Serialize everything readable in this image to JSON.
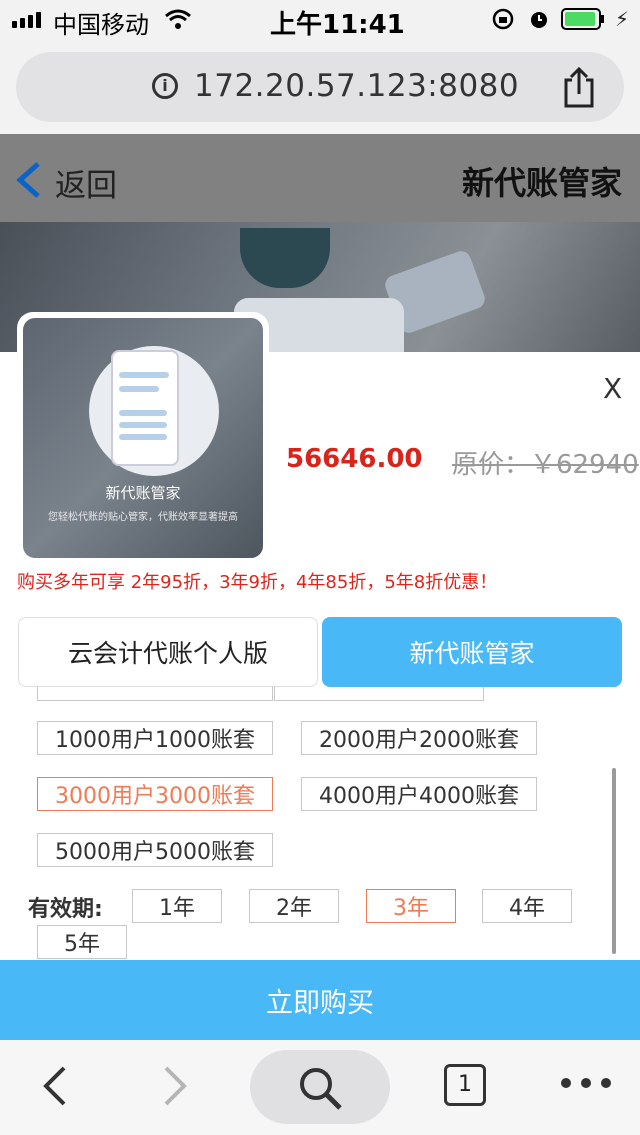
{
  "status_bar": {
    "carrier": "中国移动",
    "time": "上午11:41"
  },
  "browser": {
    "url": "172.20.57.123:8080",
    "open_tabs": "1"
  },
  "header": {
    "back_label": "返回",
    "title": "新代账管家"
  },
  "product": {
    "thumb_title": "新代账管家",
    "thumb_subtitle": "您轻松代账的贴心管家，代账效率显著提高",
    "price": "56646.00",
    "original_price": "原价：￥62940",
    "close_label": "X",
    "promo": "购买多年可享 2年95折，3年9折，4年85折，5年8折优惠！"
  },
  "tabs": [
    {
      "label": "云会计代账个人版",
      "active": false
    },
    {
      "label": "新代账管家",
      "active": true
    }
  ],
  "plans": [
    {
      "label": "1000用户1000账套",
      "selected": false
    },
    {
      "label": "2000用户2000账套",
      "selected": false
    },
    {
      "label": "3000用户3000账套",
      "selected": true
    },
    {
      "label": "4000用户4000账套",
      "selected": false
    },
    {
      "label": "5000用户5000账套",
      "selected": false
    }
  ],
  "validity": {
    "label": "有效期:",
    "options": [
      {
        "label": "1年",
        "selected": false
      },
      {
        "label": "2年",
        "selected": false
      },
      {
        "label": "3年",
        "selected": true
      },
      {
        "label": "4年",
        "selected": false
      },
      {
        "label": "5年",
        "selected": false
      }
    ]
  },
  "buy_button": "立即购买",
  "colors": {
    "accent_blue": "#49b8f7",
    "price_red": "#d9241b",
    "selected_orange": "#ef7b54"
  }
}
